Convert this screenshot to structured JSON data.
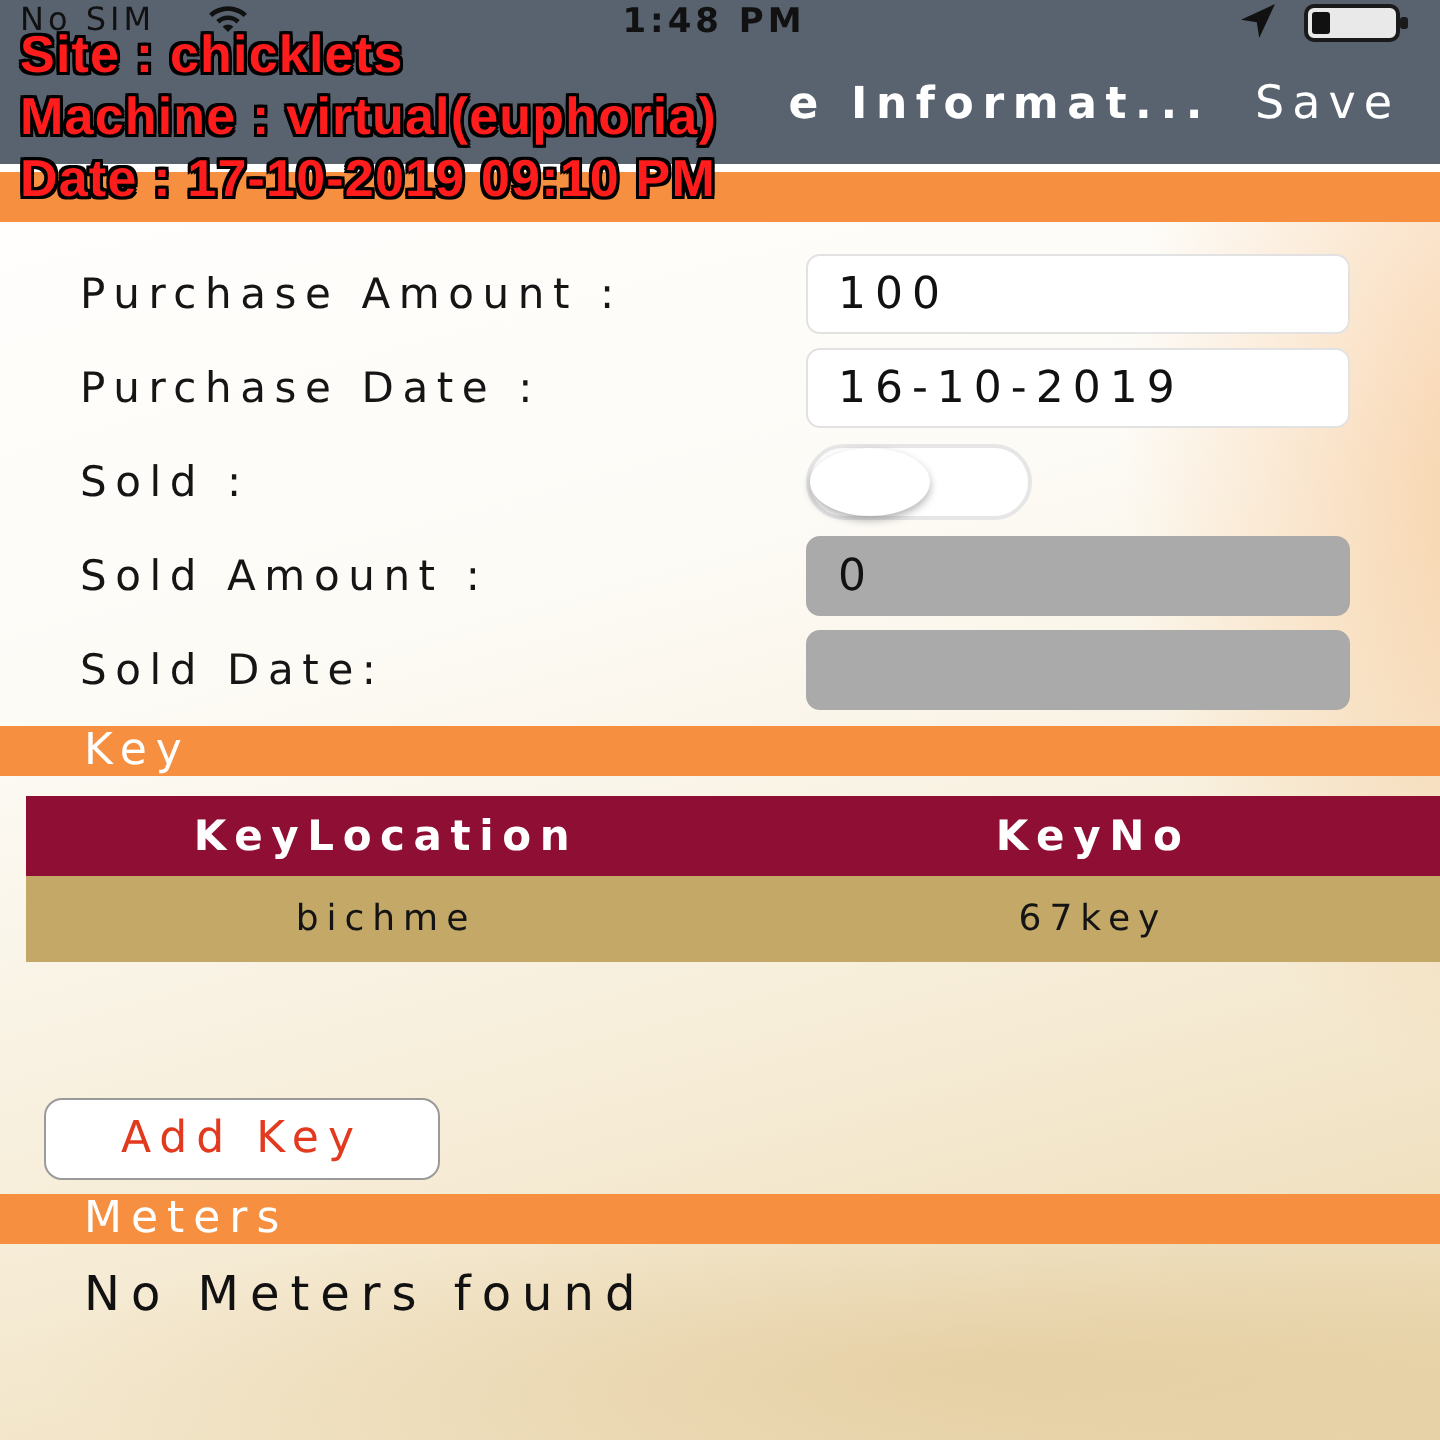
{
  "status_bar": {
    "carrier": "No SIM",
    "time": "1:48 PM"
  },
  "nav_bar": {
    "title": "e Informat...",
    "action": "Save"
  },
  "buy_sell": {
    "fields": [
      {
        "kind": "text",
        "label": "Purchase Amount :",
        "value": "100",
        "disabled": false
      },
      {
        "kind": "text",
        "label": "Purchase Date :",
        "value": "16-10-2019",
        "disabled": false
      },
      {
        "kind": "toggle",
        "label": "Sold :",
        "on": false
      },
      {
        "kind": "text",
        "label": "Sold Amount :",
        "value": "0",
        "disabled": true
      },
      {
        "kind": "text",
        "label": "Sold Date:",
        "disabled": true
      }
    ]
  },
  "key": {
    "title": "Key",
    "table": {
      "columns": [
        "KeyLocation",
        "KeyNo"
      ],
      "rows": [
        [
          "bichme",
          "67key"
        ]
      ]
    },
    "add_button": "Add Key"
  },
  "meters": {
    "title": "Meters",
    "empty_message": "No Meters found"
  },
  "stamp": {
    "lines": [
      "Site : chicklets",
      "Machine : virtual(euphoria)",
      "Date : 17-10-2019 09:10 PM"
    ]
  }
}
